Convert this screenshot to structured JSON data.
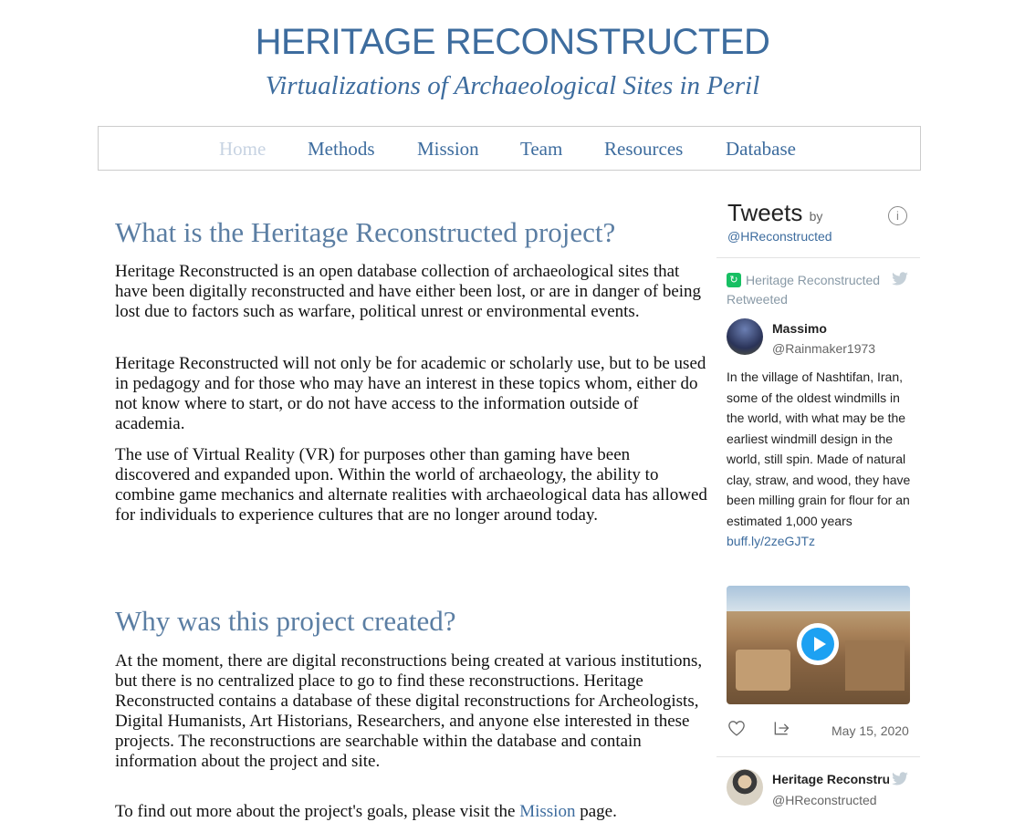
{
  "site": {
    "title": "HERITAGE RECONSTRUCTED",
    "subtitle": "Virtualizations of Archaeological Sites in Peril"
  },
  "nav": {
    "items": [
      {
        "label": "Home"
      },
      {
        "label": "Methods"
      },
      {
        "label": "Mission"
      },
      {
        "label": "Team"
      },
      {
        "label": "Resources"
      },
      {
        "label": "Database"
      }
    ]
  },
  "main": {
    "section1": {
      "heading": "What is the Heritage Reconstructed project?",
      "p1": "Heritage Reconstructed is an open database collection of archaeological sites that have been digitally reconstructed and have either been lost, or are in danger of being lost due to factors such as warfare, political unrest or environmental events.",
      "p2": "Heritage Reconstructed will not only be for academic or scholarly use, but to be used in pedagogy and for those who may have an interest in these topics whom, either do not know where to start, or do not have access to the information outside of academia.",
      "p3": "The use of Virtual Reality (VR) for purposes other than gaming have been discovered and expanded upon. Within the world of archaeology, the ability to combine game mechanics and alternate realities with archaeological data has allowed for individuals to experience cultures that are no longer around today."
    },
    "section2": {
      "heading": "Why was this project created?",
      "p1": "At the moment, there are digital reconstructions being created at various institutions, but there is no centralized place to go to find these reconstructions. Heritage Reconstructed contains a database of these digital reconstructions for Archeologists, Digital Humanists, Art Historians, Researchers, and anyone else interested in these projects. The reconstructions are searchable within the database and contain information about the project and site.",
      "p2_before": "To find out more about the project's goals, please visit the ",
      "p2_link": "Mission",
      "p2_after": " page."
    }
  },
  "tweets": {
    "header": "Tweets",
    "by": "by",
    "handle": "@HReconstructed",
    "info_icon": "i",
    "retweet_by": "Heritage Reconstructed",
    "retweeted_label": "Retweeted",
    "tweet1": {
      "name": "Massimo",
      "user": "@Rainmaker1973",
      "text": "In the village of Nashtifan, Iran, some of the oldest windmills in the world, with what may be the earliest windmill design in the world, still spin. Made of natural clay, straw, and wood, they have been milling grain for flour for an estimated 1,000 years ",
      "link": "buff.ly/2zeGJTz",
      "date": "May 15, 2020"
    },
    "tweet2": {
      "name": "Heritage Reconstructed",
      "user": "@HReconstructed"
    }
  },
  "colors": {
    "brand": "#3d6c9e",
    "nav_active": "#c7d3e2",
    "heading": "#5b7ea3",
    "twitter_blue": "#1da1f2",
    "retweet_green": "#17bf63"
  }
}
